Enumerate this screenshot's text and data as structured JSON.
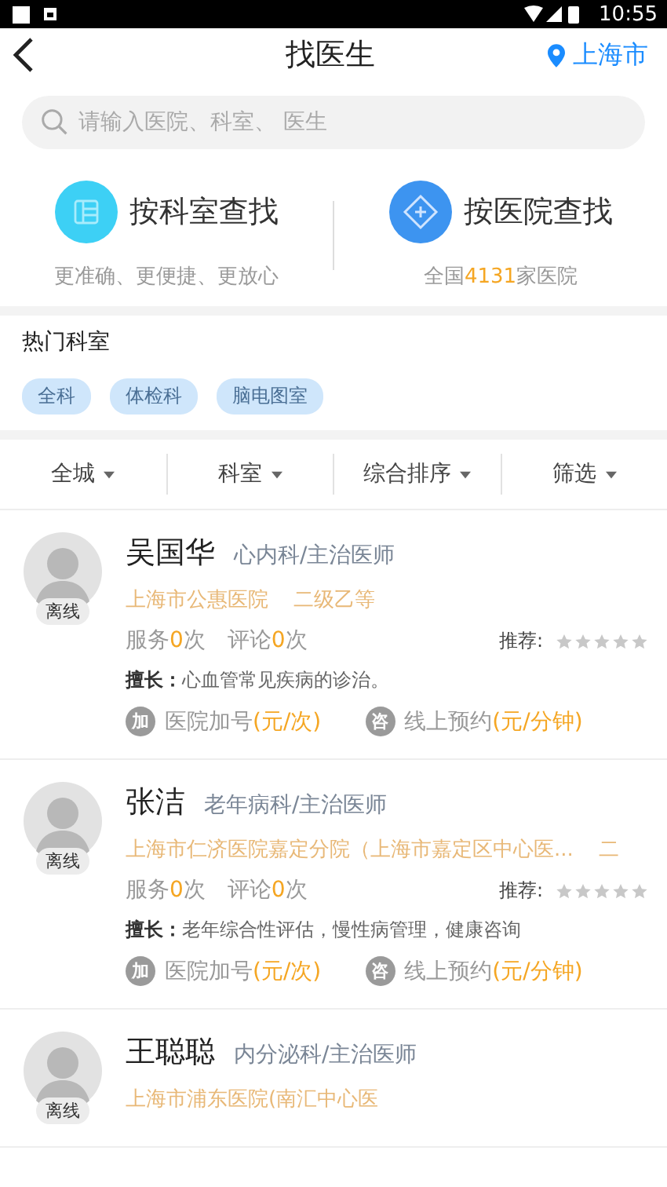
{
  "status_bar": {
    "time": "10:55"
  },
  "header": {
    "title": "找医生",
    "city": "上海市"
  },
  "search": {
    "placeholder": "请输入医院、科室、 医生"
  },
  "entries": [
    {
      "kind": "department",
      "title": "按科室查找",
      "subtitle_parts": [
        "更准确、更便捷、更放心"
      ]
    },
    {
      "kind": "hospital",
      "title": "按医院查找",
      "subtitle_parts": [
        "全国",
        "4131",
        "家医院"
      ]
    }
  ],
  "hot_departments": {
    "title": "热门科室",
    "tags": [
      "全科",
      "体检科",
      "脑电图室"
    ]
  },
  "filters": [
    {
      "label": "全城"
    },
    {
      "label": "科室"
    },
    {
      "label": "综合排序"
    },
    {
      "label": "筛选"
    }
  ],
  "doctors": [
    {
      "name": "吴国华",
      "title": "心内科/主治医师",
      "status": "离线",
      "hospital": "上海市公惠医院",
      "level": "二级乙等",
      "stats": [
        {
          "label": "服务",
          "count": "0",
          "unit": "次"
        },
        {
          "label": "评论",
          "count": "0",
          "unit": "次"
        }
      ],
      "rating_label": "推荐:",
      "stars": 0,
      "specialty_label": "擅长：",
      "specialty": "心血管常见疾病的诊治。",
      "services": [
        {
          "icon": "加",
          "label": "医院加号",
          "price": "(元/次)"
        },
        {
          "icon": "咨",
          "label": "线上预约",
          "price": "(元/分钟)"
        }
      ]
    },
    {
      "name": "张洁",
      "title": "老年病科/主治医师",
      "status": "离线",
      "hospital": "上海市仁济医院嘉定分院（上海市嘉定区中心医...",
      "level": "二",
      "stats": [
        {
          "label": "服务",
          "count": "0",
          "unit": "次"
        },
        {
          "label": "评论",
          "count": "0",
          "unit": "次"
        }
      ],
      "rating_label": "推荐:",
      "stars": 0,
      "specialty_label": "擅长：",
      "specialty": "老年综合性评估，慢性病管理，健康咨询",
      "services": [
        {
          "icon": "加",
          "label": "医院加号",
          "price": "(元/次)"
        },
        {
          "icon": "咨",
          "label": "线上预约",
          "price": "(元/分钟)"
        }
      ]
    },
    {
      "name": "王聪聪",
      "title": "内分泌科/主治医师",
      "status": "离线",
      "hospital": "上海市浦东医院(南汇中心医"
    }
  ]
}
